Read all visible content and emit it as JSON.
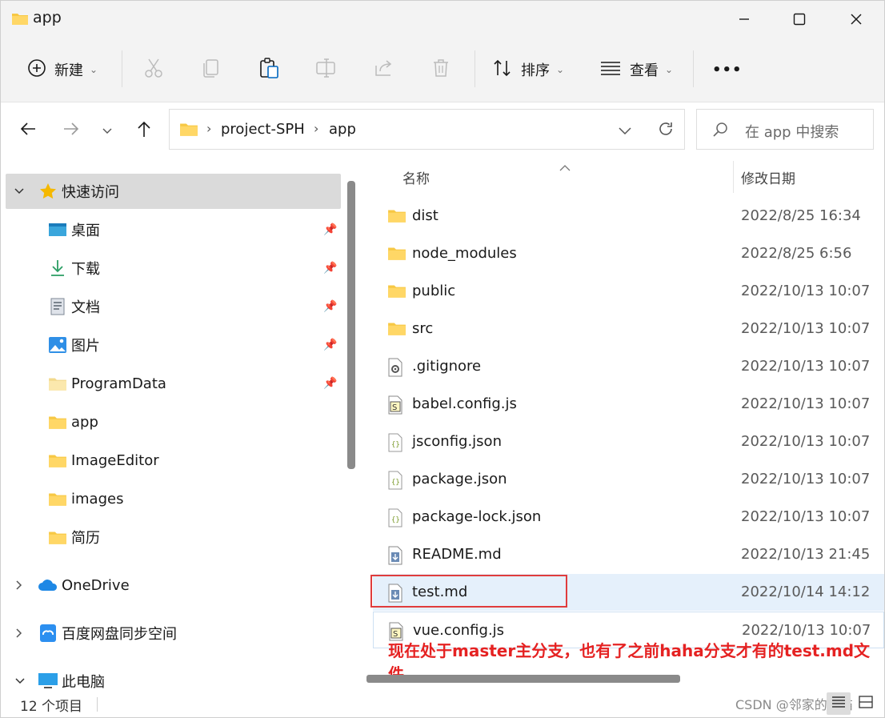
{
  "window": {
    "title": "app"
  },
  "toolbar": {
    "new_label": "新建",
    "sort_label": "排序",
    "view_label": "查看",
    "more_label": "•••"
  },
  "address": {
    "segments": [
      "project-SPH",
      "app"
    ]
  },
  "search": {
    "placeholder": "在 app 中搜索"
  },
  "sidebar": {
    "quick_access": "快速访问",
    "items": [
      {
        "label": "桌面",
        "pinned": true
      },
      {
        "label": "下载",
        "pinned": true
      },
      {
        "label": "文档",
        "pinned": true
      },
      {
        "label": "图片",
        "pinned": true
      },
      {
        "label": "ProgramData",
        "pinned": true
      },
      {
        "label": "app",
        "pinned": false
      },
      {
        "label": "ImageEditor",
        "pinned": false
      },
      {
        "label": "images",
        "pinned": false
      },
      {
        "label": "简历",
        "pinned": false
      }
    ],
    "onedrive": "OneDrive",
    "baidu": "百度网盘同步空间",
    "thispc": "此电脑"
  },
  "columns": {
    "name": "名称",
    "date": "修改日期"
  },
  "files": [
    {
      "name": "dist",
      "date": "2022/8/25 16:34",
      "icon": "folder-icon"
    },
    {
      "name": "node_modules",
      "date": "2022/8/25 6:56",
      "icon": "folder-icon"
    },
    {
      "name": "public",
      "date": "2022/10/13 10:07",
      "icon": "folder-icon"
    },
    {
      "name": "src",
      "date": "2022/10/13 10:07",
      "icon": "folder-icon"
    },
    {
      "name": ".gitignore",
      "date": "2022/10/13 10:07",
      "icon": "config-file-icon"
    },
    {
      "name": "babel.config.js",
      "date": "2022/10/13 10:07",
      "icon": "js-file-icon"
    },
    {
      "name": "jsconfig.json",
      "date": "2022/10/13 10:07",
      "icon": "json-file-icon"
    },
    {
      "name": "package.json",
      "date": "2022/10/13 10:07",
      "icon": "json-file-icon"
    },
    {
      "name": "package-lock.json",
      "date": "2022/10/13 10:07",
      "icon": "json-file-icon"
    },
    {
      "name": "README.md",
      "date": "2022/10/13 21:45",
      "icon": "md-file-icon"
    },
    {
      "name": "test.md",
      "date": "2022/10/14 14:12",
      "icon": "md-file-icon"
    },
    {
      "name": "vue.config.js",
      "date": "2022/10/13 10:07",
      "icon": "js-file-icon"
    }
  ],
  "annotation": "现在处于master主分支，也有了之前haha分支才有的test.md文件",
  "status": {
    "count": "12 个项目"
  },
  "watermark": "CSDN @邻家的吧猫",
  "colors": {
    "accent": "#0067c0",
    "annotation": "#e52222",
    "selection": "#e5f0fb",
    "folder": "#f7c844"
  }
}
